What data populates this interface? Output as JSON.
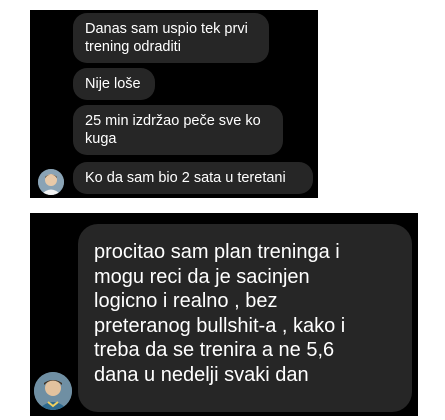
{
  "screenshot_1": {
    "messages": [
      {
        "lines": [
          "Danas sam uspio tek prvi",
          "trening odraditi"
        ]
      },
      {
        "lines": [
          "Nije loše"
        ]
      },
      {
        "lines": [
          "25 min izdržao peče sve ko",
          "kuga"
        ]
      },
      {
        "lines": [
          "Ko da sam bio 2 sata u teretani"
        ]
      }
    ],
    "avatar_icon": "user-avatar-icon"
  },
  "screenshot_2": {
    "messages": [
      {
        "lines": [
          "procitao sam plan treninga i",
          "mogu reci da je sacinjen",
          "logicno i realno , bez",
          "preteranog bullshit-a , kako i",
          "treba da se trenira a ne 5,6",
          "dana u nedelji svaki dan"
        ]
      }
    ],
    "avatar_icon": "user-avatar-icon"
  },
  "colors": {
    "background": "#000000",
    "bubble": "#262626",
    "text": "#ffffff"
  }
}
